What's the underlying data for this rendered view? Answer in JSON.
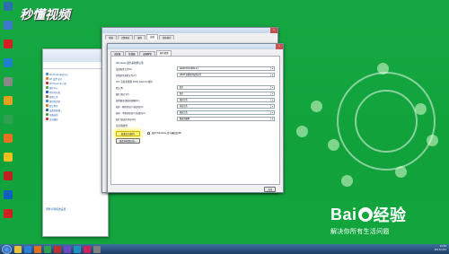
{
  "desktop_icons": [
    {
      "icon": "recycle-bin-icon",
      "label": "",
      "color": "#2a6fb0"
    },
    {
      "icon": "computer-icon",
      "label": "",
      "color": "#3b78c8"
    },
    {
      "icon": "app-icon-red",
      "label": "",
      "color": "#d02020"
    },
    {
      "icon": "app-icon-blue",
      "label": "",
      "color": "#2080d0"
    },
    {
      "icon": "app-icon-grey",
      "label": "",
      "color": "#888888"
    },
    {
      "icon": "chrome-icon",
      "label": "",
      "color": "#e0a020"
    },
    {
      "icon": "app-icon-green",
      "label": "",
      "color": "#30a050"
    },
    {
      "icon": "app-icon-orange",
      "label": "",
      "color": "#e87020"
    },
    {
      "icon": "app-icon-yellow",
      "label": "",
      "color": "#f0c020"
    },
    {
      "icon": "app-icon-red2",
      "label": "",
      "color": "#c02020"
    },
    {
      "icon": "app-icon-blue2",
      "label": "",
      "color": "#1060c0"
    },
    {
      "icon": "netease-icon",
      "label": "",
      "color": "#d02020"
    }
  ],
  "watermark": {
    "brand": "秒懂视频"
  },
  "control_panel": {
    "items": [
      "Windows 移动中心",
      "PC 设置 显示",
      "Windows 防火墙",
      "操作中心",
      "程序和功能",
      "管理工具",
      "备份和还原",
      "默认程序",
      "设备管理器",
      "电源选项",
      "自动播放"
    ],
    "footer": "调整计算机的设置"
  },
  "system_properties": {
    "tabs": [
      "常规",
      "计算机名",
      "硬件",
      "高级",
      "系统保护"
    ],
    "active_tab": 3
  },
  "adapter_dialog": {
    "tabs": [
      "适配器",
      "监视器",
      "疑难解答",
      "颜色管理"
    ],
    "active_tab": 3,
    "group1": "Windows 颜色系统默认值",
    "rows1": [
      {
        "label": "设备配置文件(D)",
        "value": "sRGB IEC61966-2.1"
      },
      {
        "label": "查看条件配置文件(V)",
        "value": "sRGB 查看条件配置文件"
      }
    ],
    "group2": "ICC 渲染意图到 WCS Gamut 映射",
    "rows2": [
      {
        "label": "默认(E)",
        "value": "照片"
      },
      {
        "label": "图片(照片)(P)",
        "value": "照片"
      },
      {
        "label": "线条图形(图表和图解)(L)",
        "value": "相对比色"
      },
      {
        "label": "校样 - 模拟纸张/介质颜色(S)",
        "value": "绝对比色"
      },
      {
        "label": "校样 - 不模拟纸张/介质颜色(A)",
        "value": "相对比色"
      },
      {
        "label": "相片(渐变的色彩)(G)",
        "value": "图表和图解"
      }
    ],
    "group3": "显示器校准",
    "calibrate_button": "校准显示器(C)",
    "reload_button": "更改系统默认值...",
    "checkbox_label": "使用 Windows 显示器校准(W)",
    "close_button": "关闭"
  },
  "taskbar": {
    "apps": [
      "explorer",
      "ie",
      "media",
      "app1",
      "app2",
      "app3",
      "app4",
      "app5",
      "app6"
    ],
    "time": "13:53",
    "date": "2017/1/12"
  },
  "baidu": {
    "brand": "Bai",
    "suffix": "经验",
    "slogan": "解决你所有生活问题"
  },
  "colors": {
    "desktop_green": "#13a33e",
    "highlight": "#fdf57a"
  }
}
